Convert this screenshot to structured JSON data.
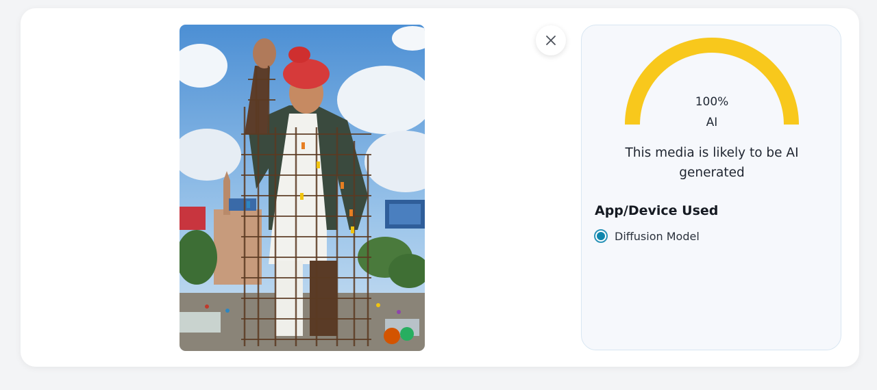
{
  "result": {
    "score_percent_text": "100%",
    "score_fraction": 1.0,
    "score_label": "AI",
    "verdict": "This media is likely to be AI generated",
    "section_title": "App/Device Used",
    "options": [
      {
        "label": "Diffusion Model",
        "selected": true
      }
    ]
  },
  "colors": {
    "gauge": "#f8c81c",
    "radio": "#0e86ad",
    "panel_border": "#d8e6f2"
  },
  "icons": {
    "close": "close-icon"
  }
}
